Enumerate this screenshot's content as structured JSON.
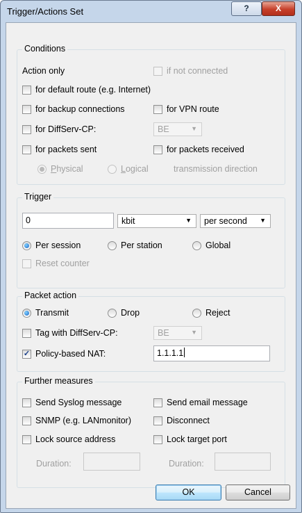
{
  "window": {
    "title": "Trigger/Actions Set",
    "help_label": "?",
    "close_label": "X"
  },
  "conditions": {
    "legend": "Conditions",
    "action_only": "Action only",
    "if_not_connected": "if not connected",
    "default_route": "for default route (e.g. Internet)",
    "backup_connections": "for backup connections",
    "vpn_route": "for VPN route",
    "diffserv_cp": "for DiffServ-CP:",
    "diffserv_value": "BE",
    "packets_sent": "for packets sent",
    "packets_received": "for packets received",
    "physical_prefix": "",
    "physical_u": "P",
    "physical_rest": "hysical",
    "logical_u": "L",
    "logical_rest": "ogical",
    "transmission_direction": "transmission direction"
  },
  "trigger": {
    "legend": "Trigger",
    "value": "0",
    "unit": "kbit",
    "period": "per second",
    "per_session": "Per session",
    "per_station": "Per station",
    "global": "Global",
    "reset_counter": "Reset counter"
  },
  "packet_action": {
    "legend": "Packet action",
    "transmit": "Transmit",
    "drop": "Drop",
    "reject": "Reject",
    "tag_diffserv": "Tag with DiffServ-CP:",
    "tag_value": "BE",
    "policy_nat": "Policy-based NAT:",
    "policy_nat_value": "1.1.1.1"
  },
  "further": {
    "legend": "Further measures",
    "syslog": "Send Syslog message",
    "email": "Send email message",
    "snmp": "SNMP (e.g. LANmonitor)",
    "disconnect": "Disconnect",
    "lock_source": "Lock source address",
    "lock_target": "Lock target port",
    "duration": "Duration:"
  },
  "buttons": {
    "ok": "OK",
    "cancel": "Cancel"
  }
}
